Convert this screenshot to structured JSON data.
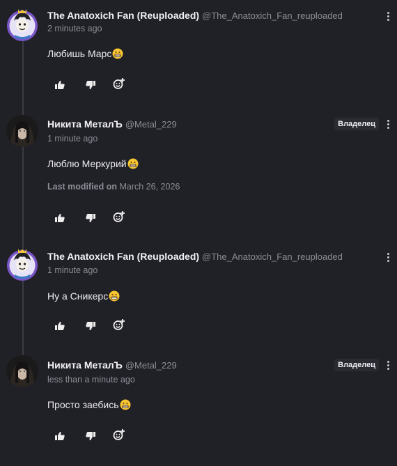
{
  "colors": {
    "background": "#202027",
    "thread_line": "#3a3a44",
    "muted_text": "#8d8d96",
    "owner_badge_bg": "#2a2a33"
  },
  "comments": [
    {
      "author": "The Anatoxich Fan (Reuploaded)",
      "handle": "@The_Anatoxich_Fan_reuploaded",
      "time": "2 minutes ago",
      "text": "Любишь Марс",
      "emoji": "grinning-face",
      "avatar": "cartoon-avatar-icon",
      "badge": ""
    },
    {
      "author": "Никита МеталЪ",
      "handle": "@Metal_229",
      "time": "1 minute ago",
      "text": "Люблю Меркурий",
      "emoji": "grinning-face",
      "avatar": "photo-avatar",
      "badge": "Владелец",
      "modified_label": "Last modified on",
      "modified_date": "March 26, 2026"
    },
    {
      "author": "The Anatoxich Fan (Reuploaded)",
      "handle": "@The_Anatoxich_Fan_reuploaded",
      "time": "1 minute ago",
      "text": "Ну а Сникерс",
      "emoji": "grinning-face",
      "avatar": "cartoon-avatar-icon",
      "badge": ""
    },
    {
      "author": "Никита МеталЪ",
      "handle": "@Metal_229",
      "time": "less than a minute ago",
      "text": "Просто заебись",
      "emoji": "grinning-face",
      "avatar": "photo-avatar",
      "badge": "Владелец"
    }
  ],
  "action_icons": [
    "thumbs-up-icon",
    "thumbs-down-icon",
    "add-reaction-icon"
  ]
}
